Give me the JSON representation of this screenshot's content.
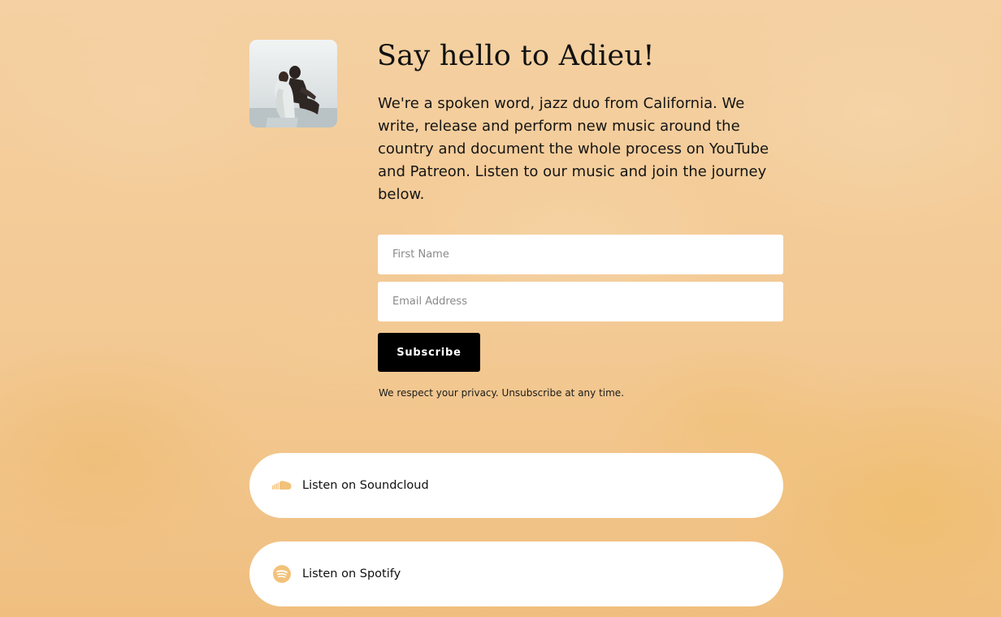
{
  "hero": {
    "title": "Say hello to Adieu!",
    "intro": "We're a spoken word, jazz duo from California. We write, release and perform new music around the country and document the whole process on YouTube and Patreon. Listen to our music and join the journey below."
  },
  "signup_form": {
    "first_name": {
      "value": "",
      "placeholder": "First Name"
    },
    "email": {
      "value": "",
      "placeholder": "Email Address"
    },
    "subscribe_label": "Subscribe",
    "privacy_note": "We respect your privacy. Unsubscribe at any time."
  },
  "links": [
    {
      "label": "Listen on Soundcloud",
      "icon": "soundcloud-icon"
    },
    {
      "label": "Listen on Spotify",
      "icon": "spotify-icon"
    }
  ],
  "colors": {
    "background": "#f2c98f",
    "icon_accent": "#f3c27a",
    "button": "#000000",
    "card": "#ffffff",
    "text": "#111111"
  }
}
